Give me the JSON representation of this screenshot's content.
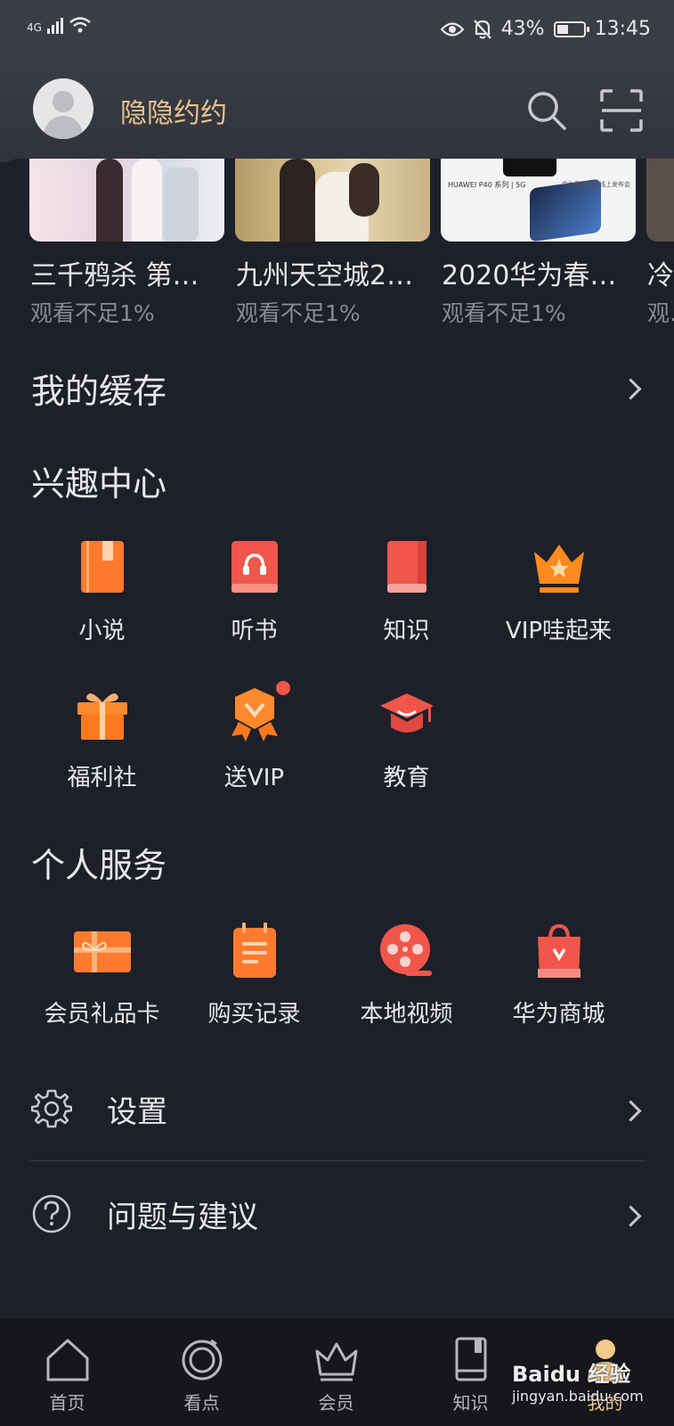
{
  "status": {
    "network": "4G",
    "battery": "43%",
    "battery_level": 0.43,
    "time": "13:45"
  },
  "header": {
    "username": "隐隐约约"
  },
  "history": [
    {
      "title": "三千鸦杀 第…",
      "sub": "观看不足1%"
    },
    {
      "title": "九州天空城2…",
      "sub": "观看不足1%"
    },
    {
      "title": "2020华为春…",
      "sub": "观看不足1%"
    },
    {
      "title": "冷…",
      "sub": "观…"
    }
  ],
  "history_thumb_text": {
    "brand": "HUAWEI P40 系列 | 5G",
    "event": "华为春季新品线上发布会"
  },
  "cache": {
    "label": "我的缓存"
  },
  "interest": {
    "title": "兴趣中心",
    "items": [
      {
        "label": "小说",
        "icon": "novel-book-icon"
      },
      {
        "label": "听书",
        "icon": "audiobook-icon"
      },
      {
        "label": "知识",
        "icon": "knowledge-book-icon"
      },
      {
        "label": "VIP哇起来",
        "icon": "vip-crown-icon"
      },
      {
        "label": "福利社",
        "icon": "gift-box-icon"
      },
      {
        "label": "送VIP",
        "icon": "vip-badge-icon"
      },
      {
        "label": "教育",
        "icon": "graduation-cap-icon"
      }
    ]
  },
  "personal": {
    "title": "个人服务",
    "items": [
      {
        "label": "会员礼品卡",
        "icon": "gift-card-icon"
      },
      {
        "label": "购买记录",
        "icon": "purchase-record-icon"
      },
      {
        "label": "本地视频",
        "icon": "film-reel-icon"
      },
      {
        "label": "华为商城",
        "icon": "shopping-bag-icon"
      }
    ]
  },
  "settings": {
    "label": "设置"
  },
  "feedback": {
    "label": "问题与建议"
  },
  "tabs": [
    {
      "label": "首页",
      "icon": "home-icon"
    },
    {
      "label": "看点",
      "icon": "circle-play-icon"
    },
    {
      "label": "会员",
      "icon": "crown-icon"
    },
    {
      "label": "知识",
      "icon": "book-icon"
    },
    {
      "label": "我的",
      "icon": "person-icon"
    }
  ],
  "watermark": {
    "line1": "Baidu 经验",
    "line2": "jingyan.baidu.com"
  },
  "colors": {
    "background": "#1d2029",
    "accent_gold": "#e8c48d",
    "icon_orange": "#ff7a2e",
    "icon_red": "#f0564a"
  }
}
